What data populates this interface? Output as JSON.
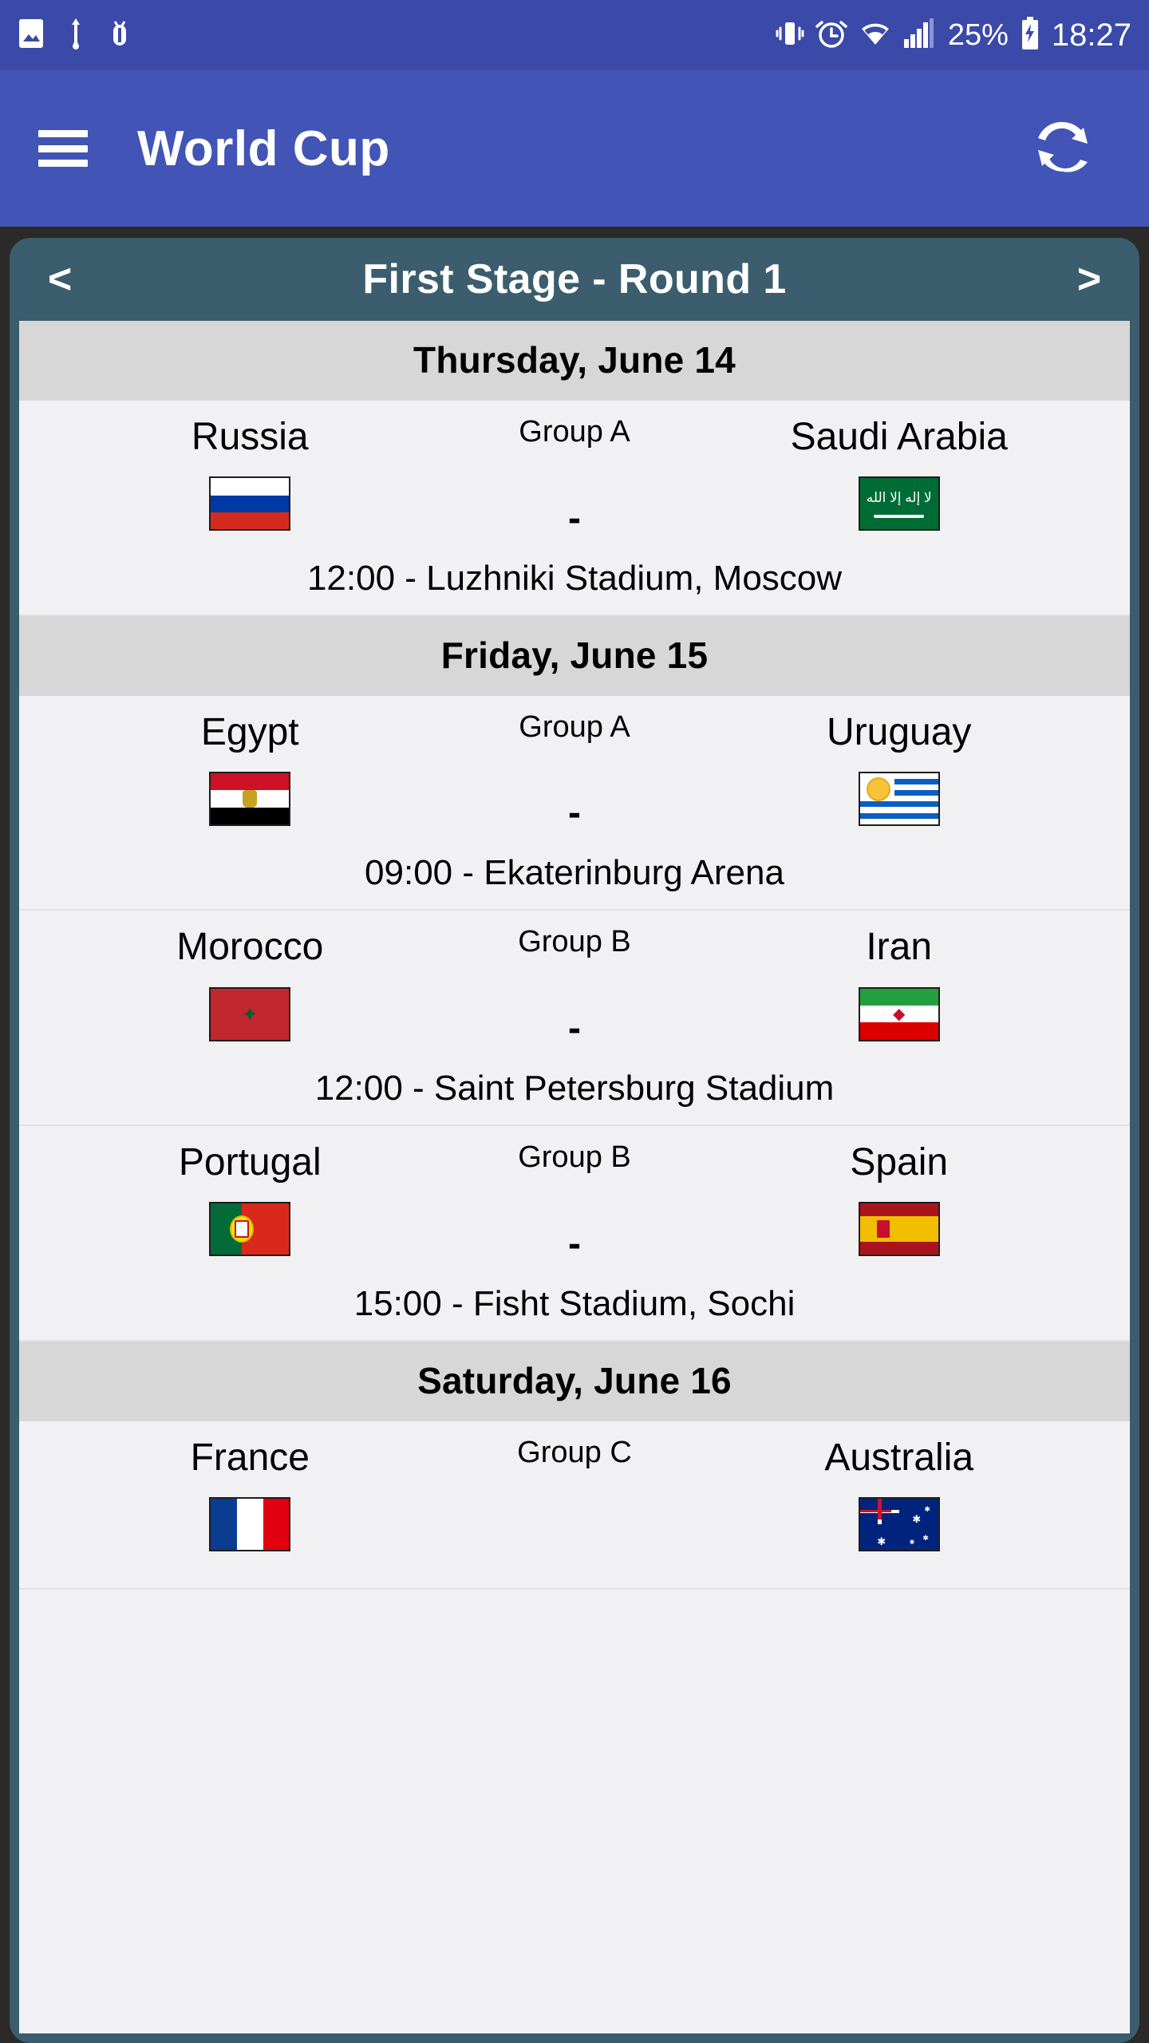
{
  "status_bar": {
    "left_icons": [
      "image-icon",
      "usb-icon",
      "bug-icon"
    ],
    "right_icons": [
      "vibrate-icon",
      "alarm-icon",
      "wifi-icon",
      "signal-icon",
      "battery-charging-icon"
    ],
    "battery_percent": "25%",
    "clock": "18:27",
    "background_color": "#3b4aa8"
  },
  "app_bar": {
    "title": "World Cup",
    "menu_icon": "hamburger-menu-icon",
    "refresh_icon": "refresh-icon",
    "background_color": "#4254b5"
  },
  "round_bar": {
    "prev_label": "<",
    "next_label": ">",
    "title": "First Stage - Round  1",
    "background_color": "#3b5d6e"
  },
  "schedule": [
    {
      "date": "Thursday, June 14",
      "matches": [
        {
          "home": "Russia",
          "away": "Saudi Arabia",
          "group": "Group A",
          "score": "-",
          "venue": "12:00 - Luzhniki Stadium, Moscow",
          "home_flag": "flag-russia",
          "away_flag": "flag-saudi-arabia"
        }
      ]
    },
    {
      "date": "Friday, June 15",
      "matches": [
        {
          "home": "Egypt",
          "away": "Uruguay",
          "group": "Group A",
          "score": "-",
          "venue": "09:00 - Ekaterinburg Arena",
          "home_flag": "flag-egypt",
          "away_flag": "flag-uruguay"
        },
        {
          "home": "Morocco",
          "away": "Iran",
          "group": "Group B",
          "score": "-",
          "venue": "12:00 - Saint Petersburg Stadium",
          "home_flag": "flag-morocco",
          "away_flag": "flag-iran"
        },
        {
          "home": "Portugal",
          "away": "Spain",
          "group": "Group B",
          "score": "-",
          "venue": "15:00 - Fisht Stadium, Sochi",
          "home_flag": "flag-portugal",
          "away_flag": "flag-spain"
        }
      ]
    },
    {
      "date": "Saturday, June 16",
      "matches": [
        {
          "home": "France",
          "away": "Australia",
          "group": "Group C",
          "score": "",
          "venue": "",
          "home_flag": "flag-france",
          "away_flag": "flag-australia"
        }
      ]
    }
  ],
  "colors": {
    "app_bar": "#4254b5",
    "status_bar": "#3b4aa8",
    "card": "#3b5d6e",
    "date_header": "#d7d7d7",
    "row": "#f1f1f3",
    "page_background": "#2b2a29"
  }
}
